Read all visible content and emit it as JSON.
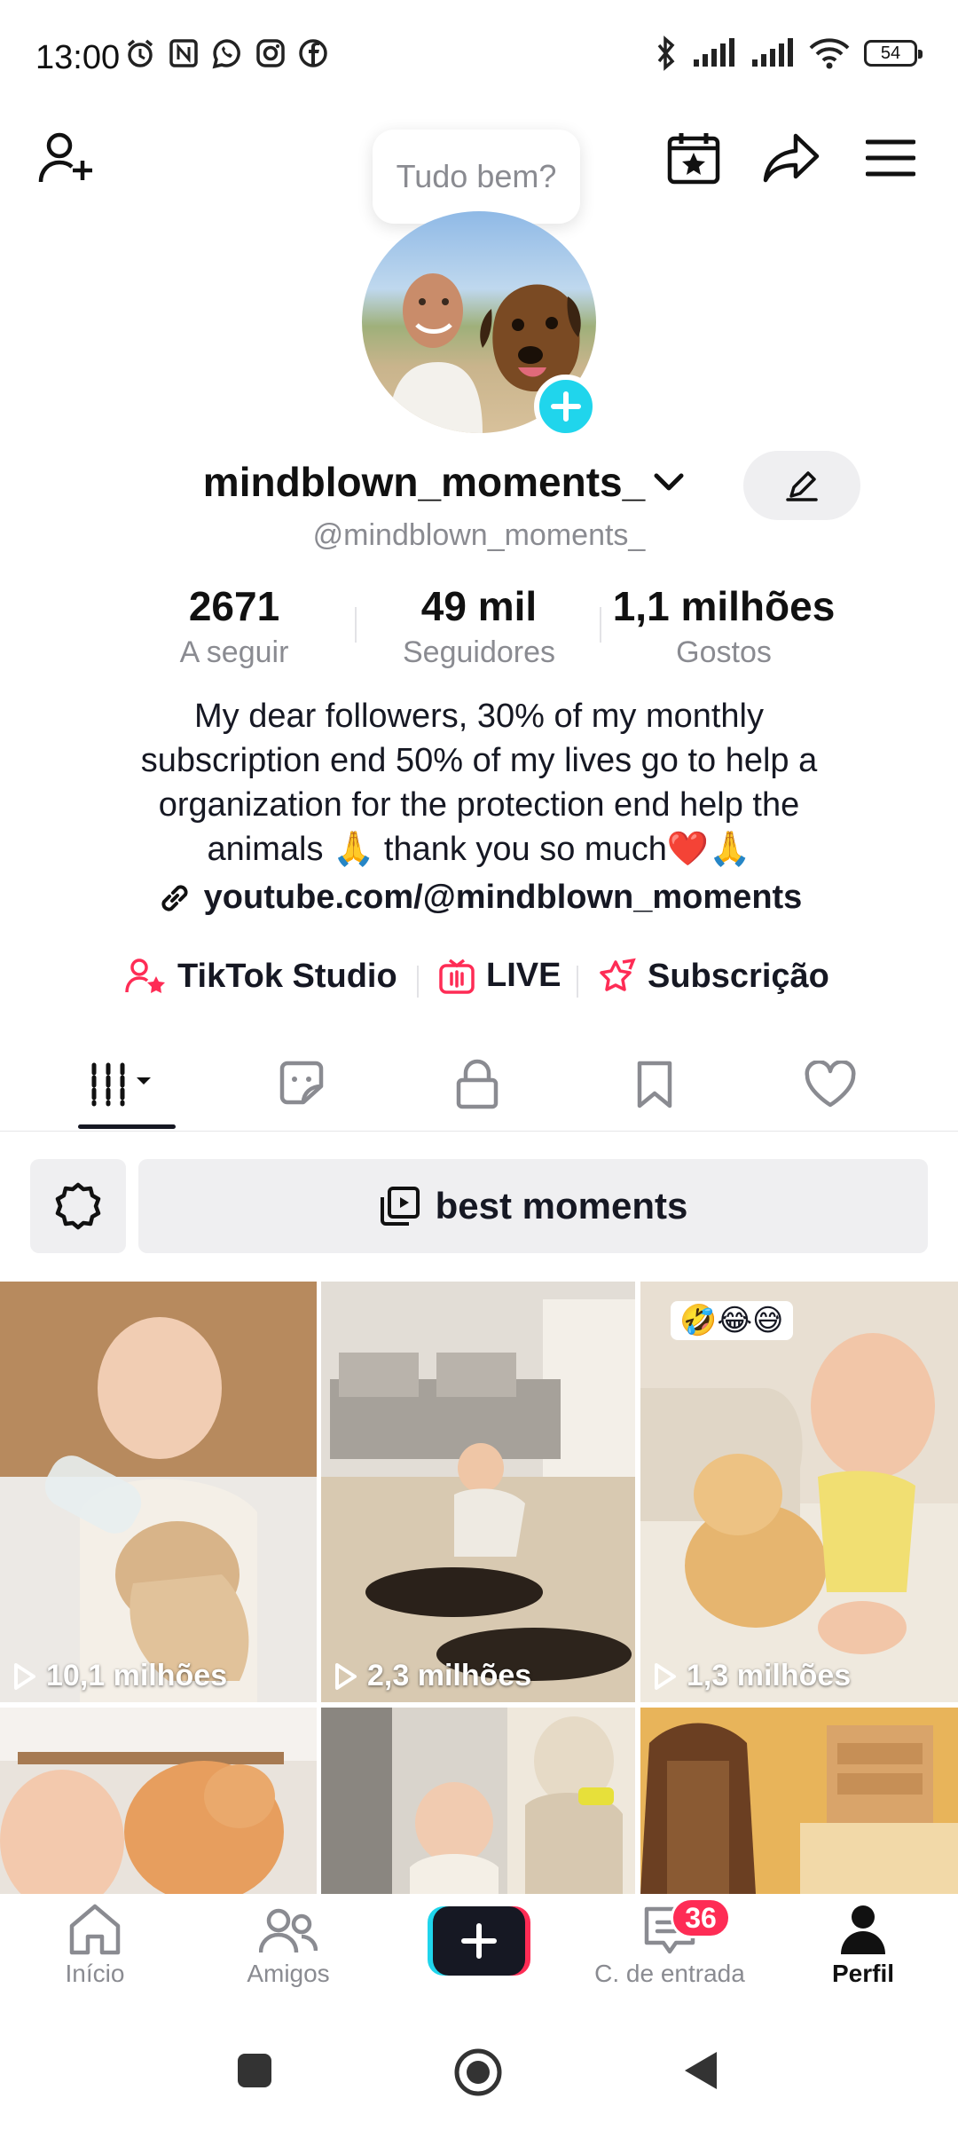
{
  "status_bar": {
    "time": "13:00",
    "battery": "54",
    "left_icons": [
      "alarm-icon",
      "nfc-icon",
      "whatsapp-icon",
      "instagram-icon",
      "facebook-icon"
    ],
    "right_icons": [
      "bluetooth-icon",
      "signal-icon",
      "signal-icon",
      "wifi-icon",
      "battery-icon"
    ]
  },
  "header": {
    "add_friend_icon": "add-user-icon",
    "calendar_icon": "calendar-star-icon",
    "share_icon": "share-icon",
    "menu_icon": "menu-icon"
  },
  "profile": {
    "bubble_text": "Tudo bem?",
    "display_name": "mindblown_moments_",
    "username": "@mindblown_moments_",
    "stats": [
      {
        "value": "2671",
        "label": "A seguir"
      },
      {
        "value": "49 mil",
        "label": "Seguidores"
      },
      {
        "value": "1,1 milhões",
        "label": "Gostos"
      }
    ],
    "bio_lines": [
      "My dear followers, 30% of my monthly",
      "subscription end 50% of my lives go to help a",
      "organization for the protection end help the",
      "animals 🙏 thank you so much❤️🙏"
    ],
    "link": "youtube.com/@mindblown_moments"
  },
  "quick_links": [
    {
      "label": "TikTok Studio",
      "icon": "studio-icon"
    },
    {
      "label": "LIVE",
      "icon": "live-icon"
    },
    {
      "label": "Subscrição",
      "icon": "subscription-icon"
    }
  ],
  "tabs": [
    "videos-grid-icon",
    "reposts-icon",
    "private-lock-icon",
    "bookmark-icon",
    "heart-icon"
  ],
  "collection": {
    "label": "best moments"
  },
  "videos": [
    {
      "views": "10,1 milhões",
      "tag": ""
    },
    {
      "views": "2,3 milhões",
      "tag": ""
    },
    {
      "views": "1,3 milhões",
      "tag": "🤣😂😅"
    },
    {
      "views": "",
      "tag": ""
    },
    {
      "views": "",
      "tag": ""
    },
    {
      "views": "",
      "tag": ""
    }
  ],
  "bottom_nav": [
    {
      "label": "Início",
      "icon": "home-icon"
    },
    {
      "label": "Amigos",
      "icon": "friends-icon"
    },
    {
      "label": "",
      "icon": "create-icon"
    },
    {
      "label": "C. de entrada",
      "icon": "inbox-icon",
      "badge": "36"
    },
    {
      "label": "Perfil",
      "icon": "profile-icon"
    }
  ],
  "colors": {
    "accent_pink": "#fe2c55",
    "accent_cyan": "#20d5ec",
    "text_primary": "#161823",
    "text_secondary": "#8a8b91"
  }
}
